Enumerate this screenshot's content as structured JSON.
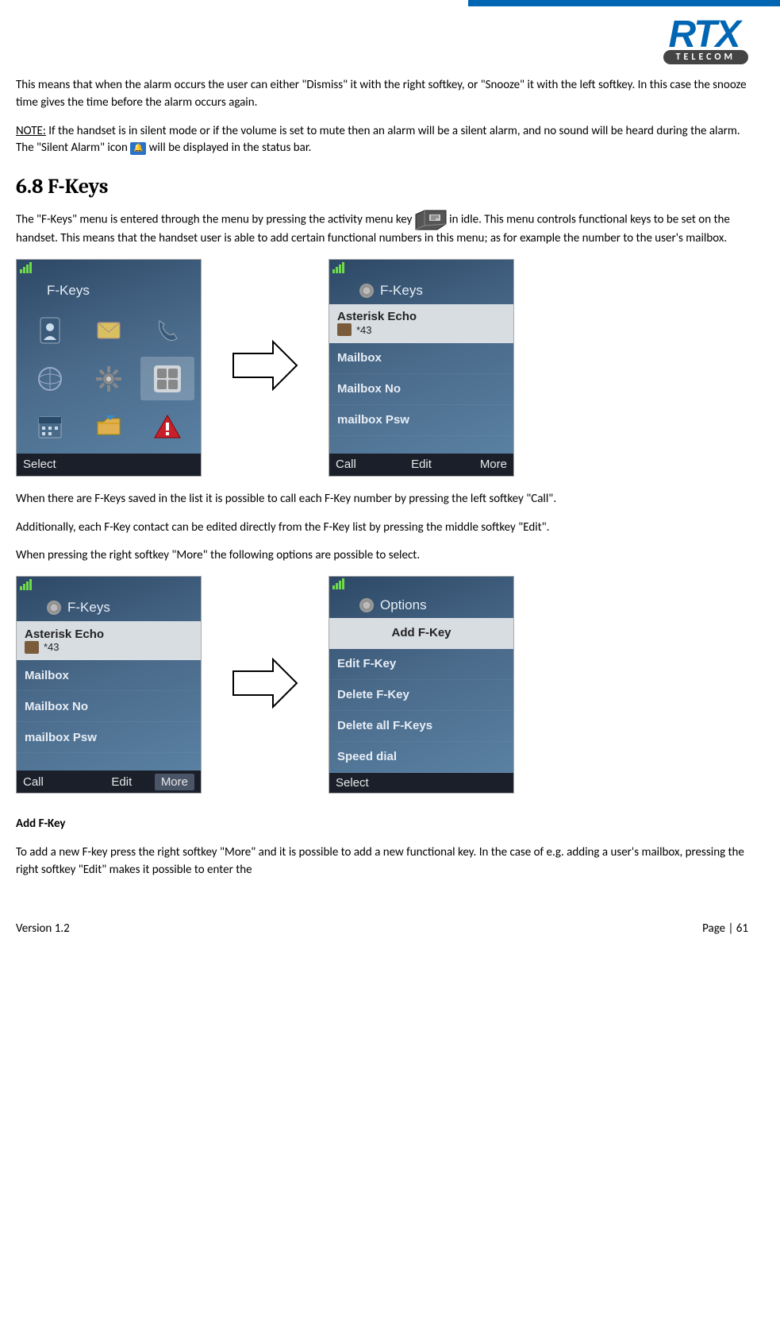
{
  "logo": {
    "brand": "RTX",
    "sub": "TELECOM"
  },
  "para1": "This means that when the alarm occurs the user can either \"Dismiss\" it with the right softkey, or \"Snooze\" it with the left softkey. In this case the snooze time gives the time before the alarm occurs again.",
  "note_label": "NOTE:",
  "note_text_a": " If the handset is in silent mode or if the volume is set to mute then an alarm will be a silent alarm, and no sound will be heard during the alarm. The \"Silent Alarm\" icon ",
  "note_text_b": " will be displayed in the status bar.",
  "heading": "6.8 F-Keys",
  "para2a": "The \"F-Keys\" menu is entered through the menu by pressing the activity menu key ",
  "para2b": " in idle. This menu controls functional keys to be set on the handset. This means that the handset user is able to add certain functional numbers in this menu; as for example the number to the user's mailbox.",
  "para3": "When there are F-Keys saved in the list it is possible to call each F-Key number by pressing the left softkey \"Call\".",
  "para4": "Additionally, each F-Key contact can be edited directly from the F-Key list by pressing the middle softkey \"Edit\".",
  "para5": "When pressing the right softkey \"More\" the following options are possible to select.",
  "subhead": "Add F-Key",
  "para6": "To add a new F-key press the right softkey \"More\" and it is possible to add a new functional key. In the case of e.g. adding a user's mailbox, pressing the right softkey \"Edit\" makes it possible to enter the",
  "footer": {
    "version": "Version 1.2",
    "page": "Page | 61"
  },
  "screen_menu": {
    "title": "F-Keys",
    "soft_left": "Select"
  },
  "screen_fkeys": {
    "title": "F-Keys",
    "sel_name": "Asterisk Echo",
    "sel_num": "*43",
    "items": [
      "Mailbox",
      "Mailbox No",
      "mailbox Psw"
    ],
    "soft_left": "Call",
    "soft_mid": "Edit",
    "soft_right": "More"
  },
  "screen_options": {
    "title": "Options",
    "sel": "Add F-Key",
    "items": [
      "Edit F-Key",
      "Delete F-Key",
      "Delete all F-Keys",
      "Speed dial"
    ],
    "soft_left": "Select"
  }
}
